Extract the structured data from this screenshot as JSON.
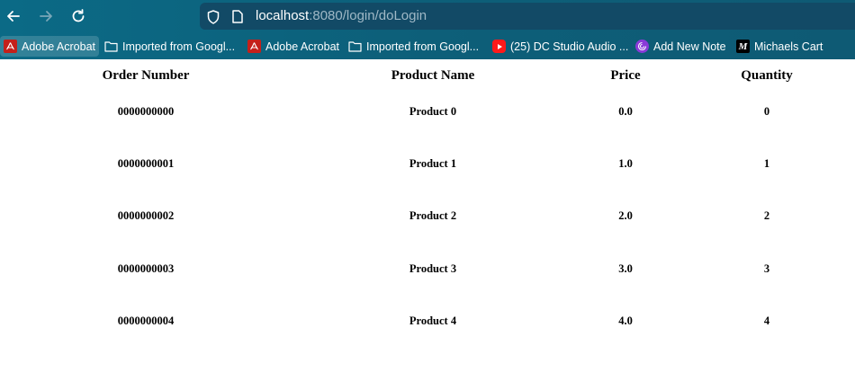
{
  "browser": {
    "url_host": "localhost",
    "url_rest": ":8080/login/doLogin",
    "bookmarks": [
      {
        "label": "Adobe Acrobat",
        "icon": "pdf-icon"
      },
      {
        "label": "Imported from Googl...",
        "icon": "folder-icon"
      },
      {
        "label": "Adobe Acrobat",
        "icon": "pdf-icon"
      },
      {
        "label": "Imported from Googl...",
        "icon": "folder-icon"
      },
      {
        "label": "(25) DC Studio Audio ...",
        "icon": "youtube-icon"
      },
      {
        "label": "Add New Note",
        "icon": "note-icon"
      },
      {
        "label": "Michaels Cart",
        "icon": "m-icon"
      }
    ]
  },
  "table": {
    "headers": [
      "Order Number",
      "Product Name",
      "Price",
      "Quantity"
    ],
    "rows": [
      [
        "0000000000",
        "Product 0",
        "0.0",
        "0"
      ],
      [
        "0000000001",
        "Product 1",
        "1.0",
        "1"
      ],
      [
        "0000000002",
        "Product 2",
        "2.0",
        "2"
      ],
      [
        "0000000003",
        "Product 3",
        "3.0",
        "3"
      ],
      [
        "0000000004",
        "Product 4",
        "4.0",
        "4"
      ]
    ]
  }
}
